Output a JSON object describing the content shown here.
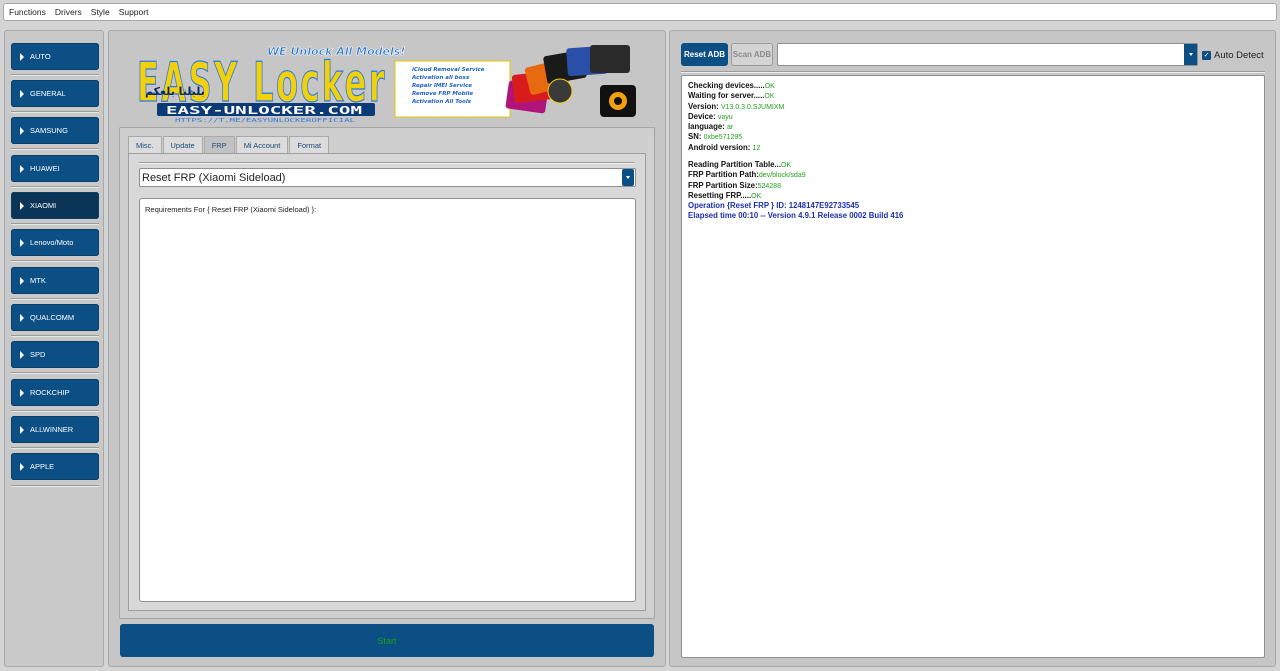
{
  "menubar": {
    "items": [
      "Functions",
      "Drivers",
      "Style",
      "Support"
    ]
  },
  "sidebar": {
    "items": [
      {
        "label": "AUTO"
      },
      {
        "label": "GENERAL"
      },
      {
        "label": "SAMSUNG"
      },
      {
        "label": "HUAWEI"
      },
      {
        "label": "XIAOMI"
      },
      {
        "label": "Lenovo/Moto"
      },
      {
        "label": "MTK"
      },
      {
        "label": "QUALCOMM"
      },
      {
        "label": "SPD"
      },
      {
        "label": "ROCKCHIP"
      },
      {
        "label": "ALLWINNER"
      },
      {
        "label": "APPLE"
      }
    ],
    "active": "XIAOMI"
  },
  "banner": {
    "headline": "WE Unlock All Models!",
    "logo_text": "EASY Locker",
    "arabic_text": "بلبلنا بلعكم",
    "url": "EASY-UNLOCKER.COM",
    "sub_url": "HTTPS://T.ME/EASYUNLOCKEROFFICIAL",
    "services": [
      "iCloud Removal Service",
      "Activation all boxs",
      "Repair IMEI Service",
      "Remove FRP Mobile",
      "Activation All Tools"
    ]
  },
  "tabs": [
    {
      "label": "Misc."
    },
    {
      "label": "Update"
    },
    {
      "label": "FRP"
    },
    {
      "label": "Mi Account"
    },
    {
      "label": "Format"
    }
  ],
  "active_tab": "FRP",
  "operation": {
    "selected": "Reset FRP  (Xiaomi Sideload)",
    "requirements": "Requirements For { Reset FRP  (Xiaomi Sideload) }:"
  },
  "start_label": "Start",
  "right": {
    "reset_adb_label": "Reset ADB",
    "scan_adb_label": "Scan ADB",
    "device_value": "",
    "auto_detect_label": "Auto Detect",
    "auto_detect_checked": true
  },
  "log": {
    "block1": [
      {
        "k": "Checking devices.....",
        "v": "OK"
      },
      {
        "k": "Waiting for server.....",
        "v": "OK"
      },
      {
        "k": "Version: ",
        "v": "V13.0.3.0.SJUMIXM"
      },
      {
        "k": "Device: ",
        "v": "vayu"
      },
      {
        "k": "language: ",
        "v": "ar"
      },
      {
        "k": "SN: ",
        "v": "0xbe571295"
      },
      {
        "k": "Android version: ",
        "v": "12"
      }
    ],
    "block2": [
      {
        "k": "Reading Partition Table...",
        "v": "OK"
      },
      {
        "k": "FRP Partition Path:",
        "v": "dev/block/sda9"
      },
      {
        "k": "FRP Partition Size:",
        "v": "524288"
      },
      {
        "k": "Resetting FRP.....",
        "v": "OK"
      }
    ],
    "operation_line": "Operation {Reset FRP } ID: 1248147E92733545",
    "elapsed_line": "Elapsed time 00:10 -- Version 4.9.1 Release 0002 Build 416"
  },
  "colors": {
    "accent": "#0c4f85",
    "ok_green": "#20a020",
    "log_blue": "#1b2fb0",
    "banner_yellow": "#f2d00a"
  }
}
